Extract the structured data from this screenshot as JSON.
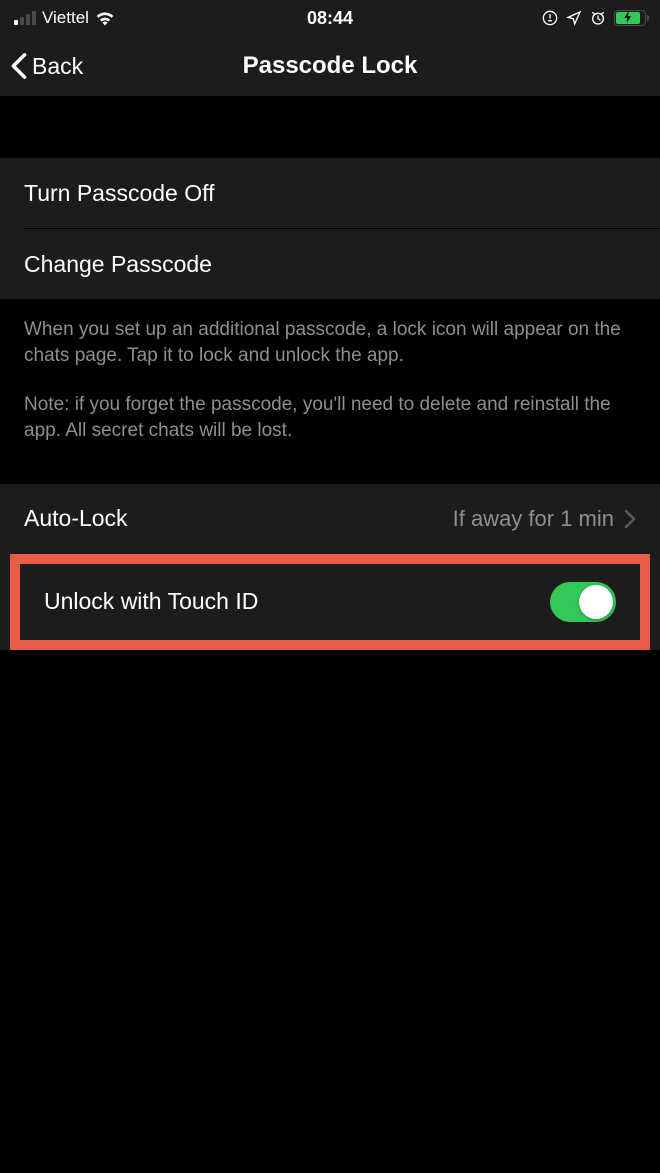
{
  "status_bar": {
    "carrier": "Viettel",
    "time": "08:44"
  },
  "nav": {
    "back_label": "Back",
    "title": "Passcode Lock"
  },
  "group1": {
    "turn_off": "Turn Passcode Off",
    "change": "Change Passcode"
  },
  "footer": {
    "p1": "When you set up an additional passcode, a lock icon will appear on the chats page. Tap it to lock and unlock the app.",
    "p2": "Note: if you forget the passcode, you'll need to delete and reinstall the app. All secret chats will be lost."
  },
  "group2": {
    "autolock_label": "Auto-Lock",
    "autolock_value": "If away for 1 min",
    "touchid_label": "Unlock with Touch ID",
    "touchid_on": true
  }
}
